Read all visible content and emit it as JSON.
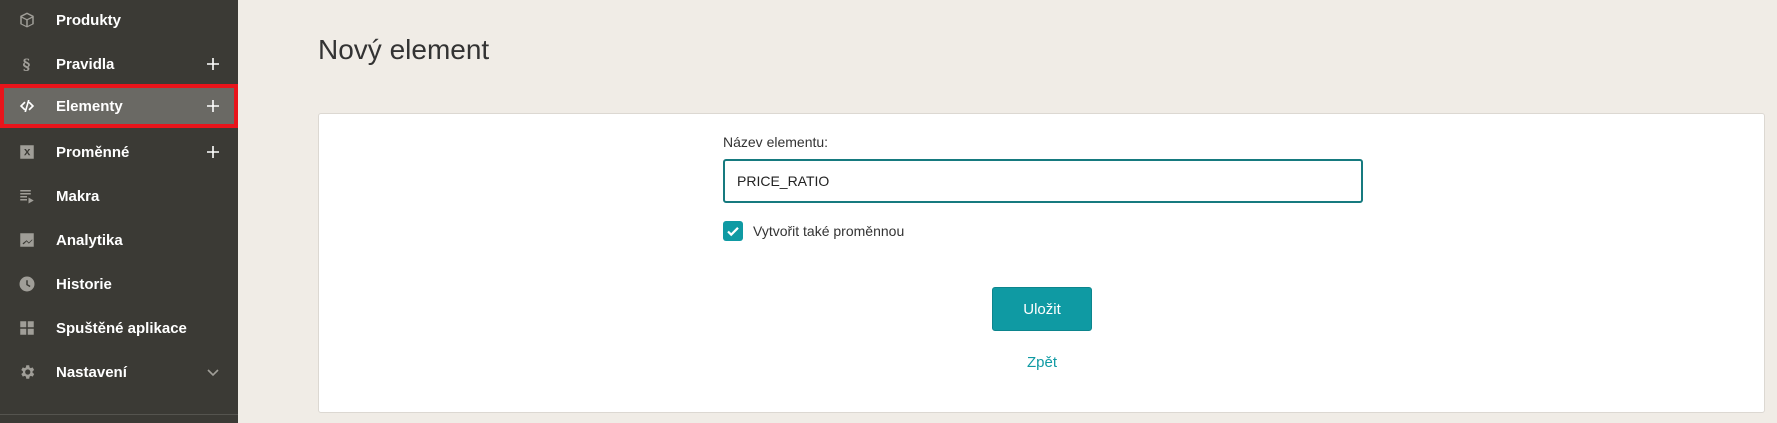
{
  "sidebar": {
    "items": [
      {
        "label": "Produkty",
        "icon": "box-icon",
        "has_plus": false
      },
      {
        "label": "Pravidla",
        "icon": "section-icon",
        "has_plus": true
      },
      {
        "label": "Elementy",
        "icon": "code-icon",
        "has_plus": true,
        "active": true
      },
      {
        "label": "Proměnné",
        "icon": "variable-icon",
        "has_plus": true
      },
      {
        "label": "Makra",
        "icon": "playlist-icon",
        "has_plus": false
      },
      {
        "label": "Analytika",
        "icon": "chart-icon",
        "has_plus": false
      },
      {
        "label": "Historie",
        "icon": "clock-icon",
        "has_plus": false
      },
      {
        "label": "Spuštěné aplikace",
        "icon": "grid-icon",
        "has_plus": false
      },
      {
        "label": "Nastavení",
        "icon": "gear-icon",
        "has_chevron": true
      }
    ]
  },
  "main": {
    "title": "Nový element",
    "form": {
      "name_label": "Název elementu:",
      "name_value": "PRICE_RATIO",
      "checkbox_label": "Vytvořit také proměnnou",
      "checkbox_checked": true,
      "save_label": "Uložit",
      "back_label": "Zpět"
    }
  },
  "colors": {
    "sidebar_bg": "#3b3a35",
    "active_bg": "#6a6964",
    "highlight": "#e8141b",
    "accent": "#0f9aa3",
    "page_bg": "#f0ece6"
  }
}
